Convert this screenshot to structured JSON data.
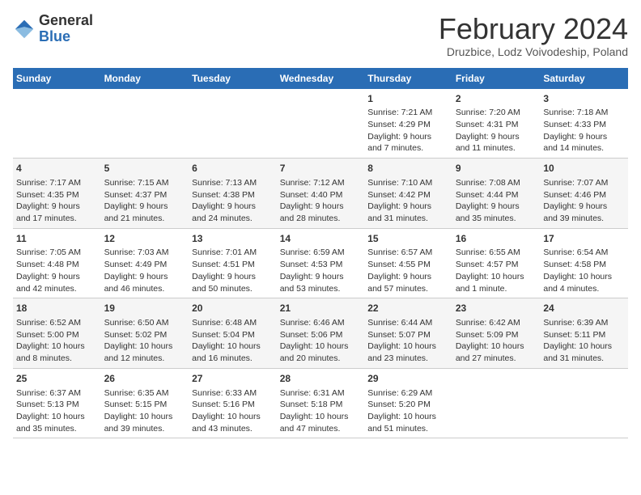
{
  "logo": {
    "line1": "General",
    "line2": "Blue"
  },
  "title": "February 2024",
  "subtitle": "Druzbice, Lodz Voivodeship, Poland",
  "days_of_week": [
    "Sunday",
    "Monday",
    "Tuesday",
    "Wednesday",
    "Thursday",
    "Friday",
    "Saturday"
  ],
  "weeks": [
    [
      {
        "day": "",
        "info": ""
      },
      {
        "day": "",
        "info": ""
      },
      {
        "day": "",
        "info": ""
      },
      {
        "day": "",
        "info": ""
      },
      {
        "day": "1",
        "info": "Sunrise: 7:21 AM\nSunset: 4:29 PM\nDaylight: 9 hours\nand 7 minutes."
      },
      {
        "day": "2",
        "info": "Sunrise: 7:20 AM\nSunset: 4:31 PM\nDaylight: 9 hours\nand 11 minutes."
      },
      {
        "day": "3",
        "info": "Sunrise: 7:18 AM\nSunset: 4:33 PM\nDaylight: 9 hours\nand 14 minutes."
      }
    ],
    [
      {
        "day": "4",
        "info": "Sunrise: 7:17 AM\nSunset: 4:35 PM\nDaylight: 9 hours\nand 17 minutes."
      },
      {
        "day": "5",
        "info": "Sunrise: 7:15 AM\nSunset: 4:37 PM\nDaylight: 9 hours\nand 21 minutes."
      },
      {
        "day": "6",
        "info": "Sunrise: 7:13 AM\nSunset: 4:38 PM\nDaylight: 9 hours\nand 24 minutes."
      },
      {
        "day": "7",
        "info": "Sunrise: 7:12 AM\nSunset: 4:40 PM\nDaylight: 9 hours\nand 28 minutes."
      },
      {
        "day": "8",
        "info": "Sunrise: 7:10 AM\nSunset: 4:42 PM\nDaylight: 9 hours\nand 31 minutes."
      },
      {
        "day": "9",
        "info": "Sunrise: 7:08 AM\nSunset: 4:44 PM\nDaylight: 9 hours\nand 35 minutes."
      },
      {
        "day": "10",
        "info": "Sunrise: 7:07 AM\nSunset: 4:46 PM\nDaylight: 9 hours\nand 39 minutes."
      }
    ],
    [
      {
        "day": "11",
        "info": "Sunrise: 7:05 AM\nSunset: 4:48 PM\nDaylight: 9 hours\nand 42 minutes."
      },
      {
        "day": "12",
        "info": "Sunrise: 7:03 AM\nSunset: 4:49 PM\nDaylight: 9 hours\nand 46 minutes."
      },
      {
        "day": "13",
        "info": "Sunrise: 7:01 AM\nSunset: 4:51 PM\nDaylight: 9 hours\nand 50 minutes."
      },
      {
        "day": "14",
        "info": "Sunrise: 6:59 AM\nSunset: 4:53 PM\nDaylight: 9 hours\nand 53 minutes."
      },
      {
        "day": "15",
        "info": "Sunrise: 6:57 AM\nSunset: 4:55 PM\nDaylight: 9 hours\nand 57 minutes."
      },
      {
        "day": "16",
        "info": "Sunrise: 6:55 AM\nSunset: 4:57 PM\nDaylight: 10 hours\nand 1 minute."
      },
      {
        "day": "17",
        "info": "Sunrise: 6:54 AM\nSunset: 4:58 PM\nDaylight: 10 hours\nand 4 minutes."
      }
    ],
    [
      {
        "day": "18",
        "info": "Sunrise: 6:52 AM\nSunset: 5:00 PM\nDaylight: 10 hours\nand 8 minutes."
      },
      {
        "day": "19",
        "info": "Sunrise: 6:50 AM\nSunset: 5:02 PM\nDaylight: 10 hours\nand 12 minutes."
      },
      {
        "day": "20",
        "info": "Sunrise: 6:48 AM\nSunset: 5:04 PM\nDaylight: 10 hours\nand 16 minutes."
      },
      {
        "day": "21",
        "info": "Sunrise: 6:46 AM\nSunset: 5:06 PM\nDaylight: 10 hours\nand 20 minutes."
      },
      {
        "day": "22",
        "info": "Sunrise: 6:44 AM\nSunset: 5:07 PM\nDaylight: 10 hours\nand 23 minutes."
      },
      {
        "day": "23",
        "info": "Sunrise: 6:42 AM\nSunset: 5:09 PM\nDaylight: 10 hours\nand 27 minutes."
      },
      {
        "day": "24",
        "info": "Sunrise: 6:39 AM\nSunset: 5:11 PM\nDaylight: 10 hours\nand 31 minutes."
      }
    ],
    [
      {
        "day": "25",
        "info": "Sunrise: 6:37 AM\nSunset: 5:13 PM\nDaylight: 10 hours\nand 35 minutes."
      },
      {
        "day": "26",
        "info": "Sunrise: 6:35 AM\nSunset: 5:15 PM\nDaylight: 10 hours\nand 39 minutes."
      },
      {
        "day": "27",
        "info": "Sunrise: 6:33 AM\nSunset: 5:16 PM\nDaylight: 10 hours\nand 43 minutes."
      },
      {
        "day": "28",
        "info": "Sunrise: 6:31 AM\nSunset: 5:18 PM\nDaylight: 10 hours\nand 47 minutes."
      },
      {
        "day": "29",
        "info": "Sunrise: 6:29 AM\nSunset: 5:20 PM\nDaylight: 10 hours\nand 51 minutes."
      },
      {
        "day": "",
        "info": ""
      },
      {
        "day": "",
        "info": ""
      }
    ]
  ]
}
